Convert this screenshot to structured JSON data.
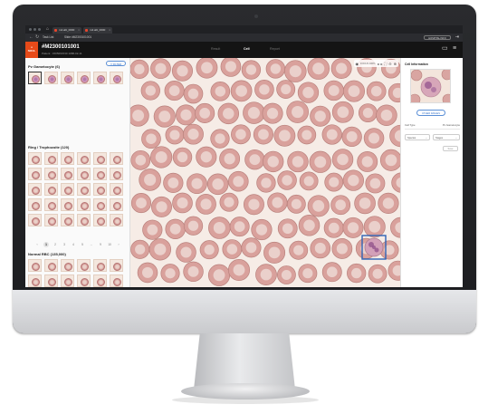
{
  "browser": {
    "tabs": [
      {
        "label": "m4.abl_0000"
      },
      {
        "label": "m4.abl_0000"
      }
    ],
    "url_text": "Task List",
    "url_slide": "Slide #M2300101001",
    "hospital_button": "HOSPITAL INFO"
  },
  "app": {
    "logo_text": "NOUL",
    "case_id": "#M2300101001",
    "patient_info": "Patient : 1505061530  1988-02-11",
    "menu": [
      {
        "label": "Result",
        "active": false
      },
      {
        "label": "Cell",
        "active": true
      },
      {
        "label": "Report",
        "active": false
      }
    ]
  },
  "left_panel": {
    "filter_label": "FILTER",
    "groups": [
      {
        "title": "Pv Gametocyte (6)",
        "thumbs": 6
      },
      {
        "title": "Ring / Trophozoite (120)",
        "thumbs": 30
      },
      {
        "title": "Normal RBC (135,000)",
        "thumbs": 12
      }
    ],
    "pager": {
      "prev": "‹",
      "pages": [
        "1",
        "2",
        "3",
        "4",
        "5",
        "...",
        "9",
        "10"
      ],
      "current": "1",
      "next": "›"
    }
  },
  "viewer": {
    "zoom_label": "FOCUS 100%"
  },
  "right_panel": {
    "title": "Cell Information",
    "other_images_label": "OTHER IMAGES",
    "cell_type_label": "Cell Type",
    "cell_type_value": "Pv Gametocyte",
    "species_select": "Species",
    "stage_select": "Stages",
    "save_label": "Save"
  },
  "colors": {
    "brand": "#e64a19",
    "accent": "#3a76cc",
    "highlight_box": "#2f63b6",
    "rbc": "#d89c98",
    "background": "#f6ece6"
  }
}
